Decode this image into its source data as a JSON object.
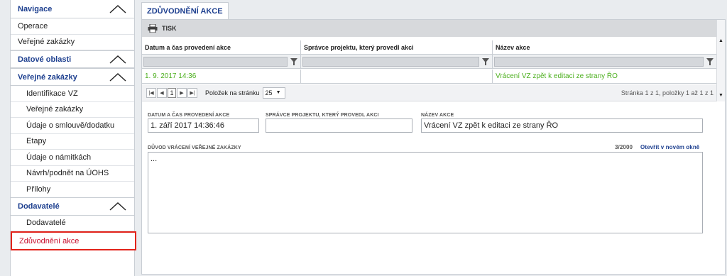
{
  "sidebar": {
    "navigation": {
      "title": "Navigace",
      "items": [
        "Operace",
        "Veřejné zakázky"
      ]
    },
    "data_areas": {
      "title": "Datové oblasti"
    },
    "public_contracts": {
      "title": "Veřejné zakázky",
      "items": [
        "Identifikace VZ",
        "Veřejné zakázky",
        "Údaje o smlouvě/dodatku",
        "Etapy",
        "Údaje o námitkách",
        "Návrh/podnět na ÚOHS",
        "Přílohy"
      ]
    },
    "suppliers": {
      "title": "Dodavatelé",
      "items": [
        "Dodavatelé"
      ]
    },
    "selected": "Zdůvodnění akce"
  },
  "tab": {
    "label": "ZDŮVODNĚNÍ AKCE"
  },
  "toolbar": {
    "print_label": "TISK",
    "icon": "printer-icon"
  },
  "grid": {
    "columns": [
      "Datum a čas provedení akce",
      "Správce projektu, který provedl akci",
      "Název akce"
    ],
    "rows": [
      {
        "datetime": "1. 9. 2017 14:36",
        "manager": "",
        "action": "Vrácení VZ zpět k editaci ze strany ŘO"
      }
    ],
    "pager": {
      "current_page": "1",
      "per_page_label": "Položek na stránku",
      "per_page": "25",
      "info": "Stránka 1 z 1, položky 1 až 1 z 1"
    }
  },
  "detail": {
    "datetime_label": "DATUM A ČAS PROVEDENÍ AKCE",
    "datetime_value": "1. září 2017 14:36:46",
    "manager_label": "SPRÁVCE PROJEKTU, KTERÝ PROVEDL AKCI",
    "manager_value": "",
    "action_label": "NÁZEV AKCE",
    "action_value": "Vrácení VZ zpět k editaci ze strany ŘO",
    "reason_label": "DŮVOD VRÁCENÍ VEŘEJNÉ ZAKÁZKY",
    "reason_counter": "3/2000",
    "open_new_window": "Otevřít v novém okně",
    "reason_value": "..."
  },
  "colors": {
    "accent": "#1d3f8f",
    "green_text": "#4caf1e",
    "selected_border": "#e2231a"
  }
}
